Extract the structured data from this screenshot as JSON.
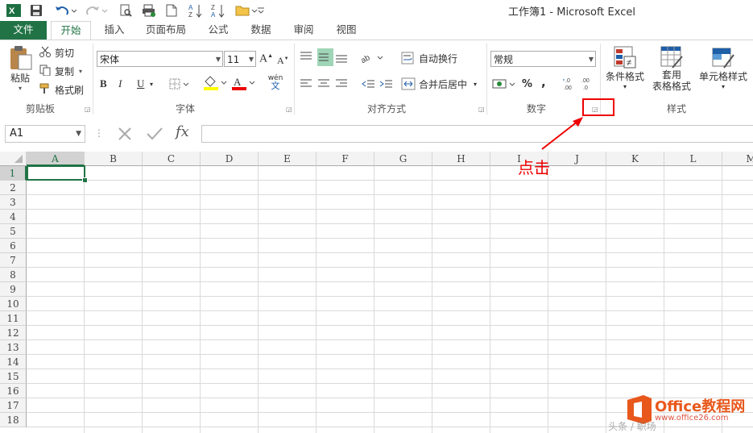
{
  "window": {
    "title": "工作簿1 - Microsoft Excel"
  },
  "tabs": {
    "file": "文件",
    "home": "开始",
    "insert": "插入",
    "page_layout": "页面布局",
    "formulas": "公式",
    "data": "数据",
    "review": "审阅",
    "view": "视图"
  },
  "clipboard": {
    "paste": "粘贴",
    "cut": "剪切",
    "copy": "复制",
    "format_painter": "格式刷",
    "group_label": "剪贴板"
  },
  "font": {
    "name": "宋体",
    "size": "11",
    "group_label": "字体",
    "bold": "B",
    "italic": "I",
    "underline": "U",
    "wen": "wén"
  },
  "alignment": {
    "wrap_text": "自动换行",
    "merge_center": "合并后居中",
    "group_label": "对齐方式"
  },
  "number": {
    "format": "常规",
    "percent": "%",
    "comma": ",",
    "group_label": "数字"
  },
  "styles": {
    "conditional": "条件格式",
    "table_line1": "套用",
    "table_line2": "表格格式",
    "cell_styles": "单元格样式",
    "group_label": "样式"
  },
  "formula_bar": {
    "name_box": "A1",
    "fx": "fx",
    "value": ""
  },
  "grid": {
    "columns": [
      "A",
      "B",
      "C",
      "D",
      "E",
      "F",
      "G",
      "H",
      "I",
      "J",
      "K",
      "L",
      "M"
    ],
    "rows": [
      "1",
      "2",
      "3",
      "4",
      "5",
      "6",
      "7",
      "8",
      "9",
      "10",
      "11",
      "12",
      "13",
      "14",
      "15",
      "16",
      "17",
      "18"
    ],
    "selected_cell": "A1"
  },
  "annotation": {
    "text": "点击"
  },
  "watermark": {
    "text1": "Office教程网",
    "text2": "www.office26.com",
    "text3": "头条 / 职场"
  },
  "colors": {
    "accent": "#217346",
    "annotation": "#e00000"
  }
}
